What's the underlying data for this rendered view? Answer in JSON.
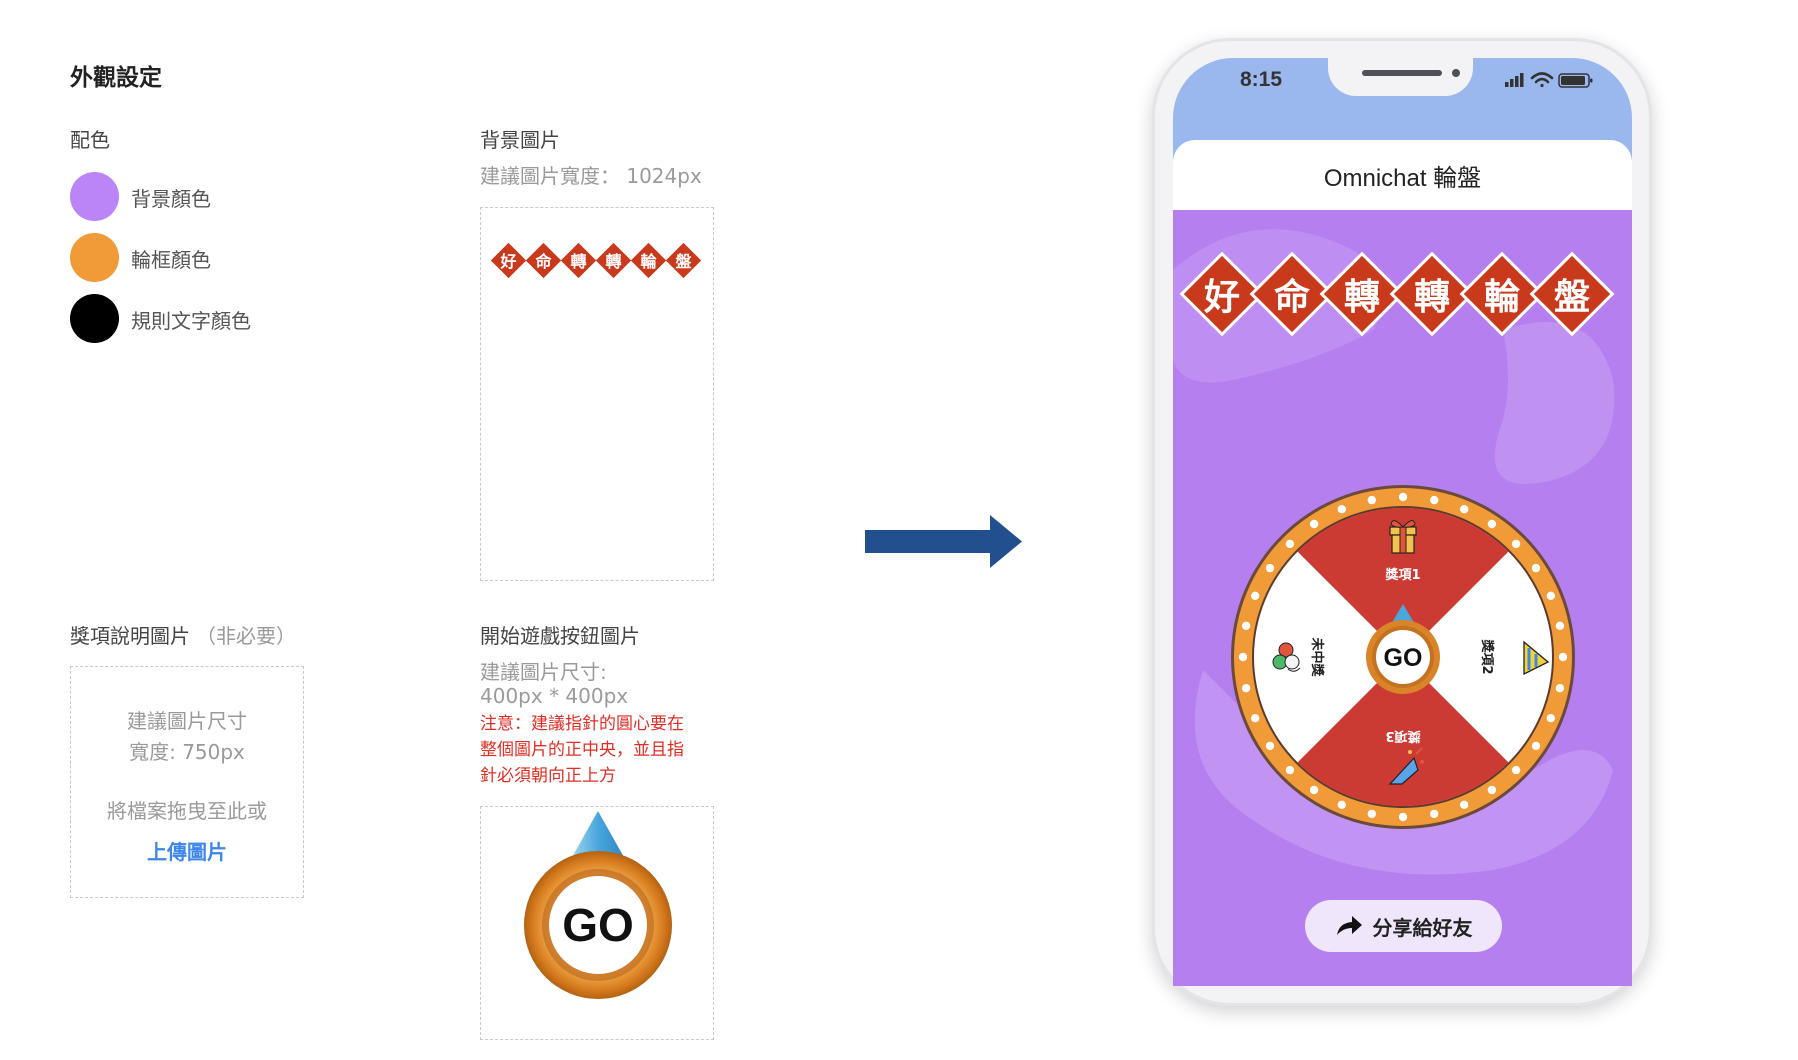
{
  "settings": {
    "section_title": "外觀設定",
    "color_scheme_label": "配色",
    "colors": [
      {
        "label": "背景顏色",
        "value": "#bc85f7"
      },
      {
        "label": "輪框顏色",
        "value": "#f09a38"
      },
      {
        "label": "規則文字顏色",
        "value": "#000000"
      }
    ],
    "bg_image": {
      "title": "背景圖片",
      "hint": "建議圖片寬度： 1024px",
      "banner_chars": [
        "好",
        "命",
        "轉",
        "轉",
        "輪",
        "盤"
      ]
    },
    "prize_image": {
      "title": "獎項說明圖片",
      "optional": "（非必要）",
      "hint_line1": "建議圖片尺寸",
      "hint_line2": "寬度: 750px",
      "drop_text": "將檔案拖曳至此或",
      "upload_link": "上傳圖片"
    },
    "start_button_image": {
      "title": "開始遊戲按鈕圖片",
      "hint_line1": "建議圖片尺寸:",
      "hint_line2": "400px * 400px",
      "warning_line1": "注意：建議指針的圓心要在",
      "warning_line2": "整個圖片的正中央，並且指",
      "warning_line3": "針必須朝向正上方",
      "go_text": "GO"
    }
  },
  "arrow_icon": "arrow-right-icon",
  "phone": {
    "time": "8:15",
    "app_title": "Omnichat 輪盤",
    "banner_chars": [
      "好",
      "命",
      "轉",
      "轉",
      "輪",
      "盤"
    ],
    "wheel": {
      "segments": [
        {
          "label": "獎項1",
          "icon": "gift-icon",
          "color": "#cc3b33"
        },
        {
          "label": "獎項2",
          "icon": "party-hat-icon",
          "color": "#ffffff"
        },
        {
          "label": "獎項3",
          "icon": "party-popper-icon",
          "color": "#cc3b33"
        },
        {
          "label": "未中獎",
          "icon": "balloons-icon",
          "color": "#ffffff"
        }
      ],
      "go_text": "GO",
      "rim_color": "#f09a38"
    },
    "share_label": "分享給好友"
  }
}
